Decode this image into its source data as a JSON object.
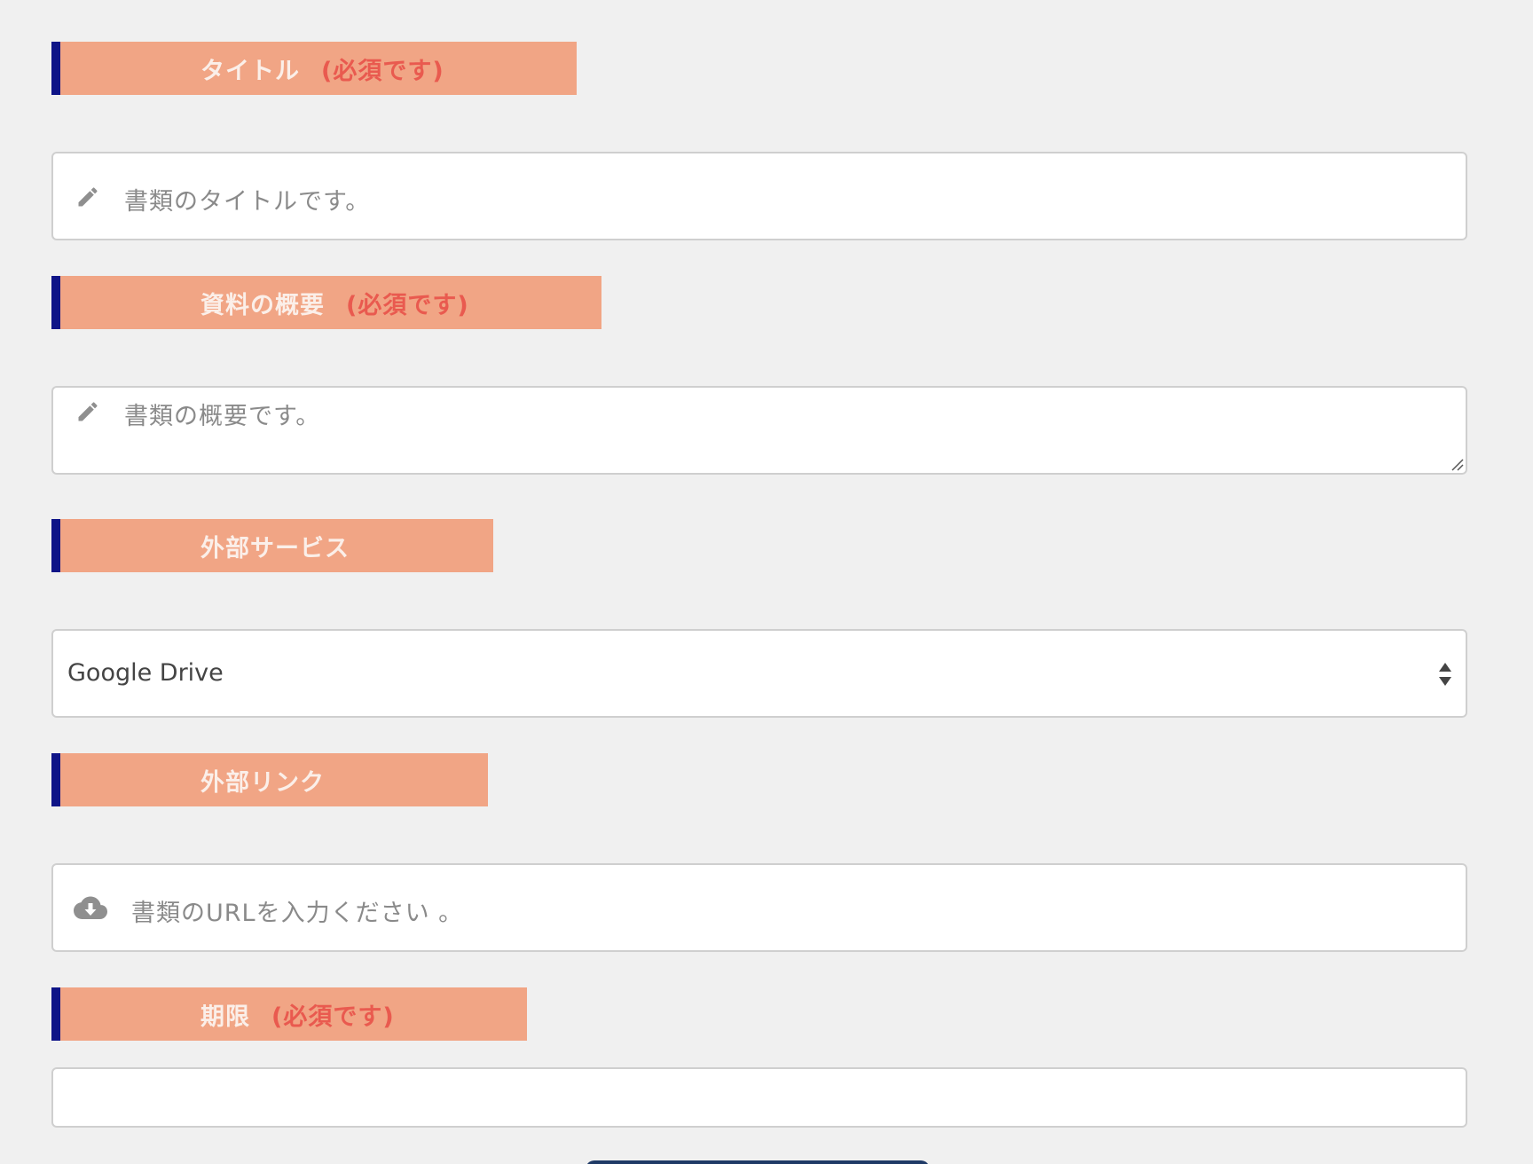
{
  "colors": {
    "page_background": "#f0f0f0",
    "label_background": "#f1a585",
    "label_accent_bar": "#0f1487",
    "label_text": "#fbefe9",
    "required_text": "#e95a4f",
    "placeholder_text": "#8a8a8a",
    "icon": "#8f8f8f"
  },
  "title_section": {
    "label": "タイトル",
    "required": "(必須です)",
    "input": {
      "icon": "pencil-icon",
      "placeholder": "書類のタイトルです。"
    }
  },
  "summary_section": {
    "label": "資料の概要",
    "required": "(必須です)",
    "textarea": {
      "icon": "pencil-icon",
      "placeholder": "書類の概要です。"
    }
  },
  "service_section": {
    "label": "外部サービス",
    "select": {
      "selected": "Google Drive"
    }
  },
  "link_section": {
    "label": "外部リンク",
    "input": {
      "icon": "cloud-download-icon",
      "placeholder": "書類のURLを入力ください 。"
    }
  },
  "deadline_section": {
    "label": "期限",
    "required": "(必須です)",
    "input": {
      "value": ""
    }
  }
}
